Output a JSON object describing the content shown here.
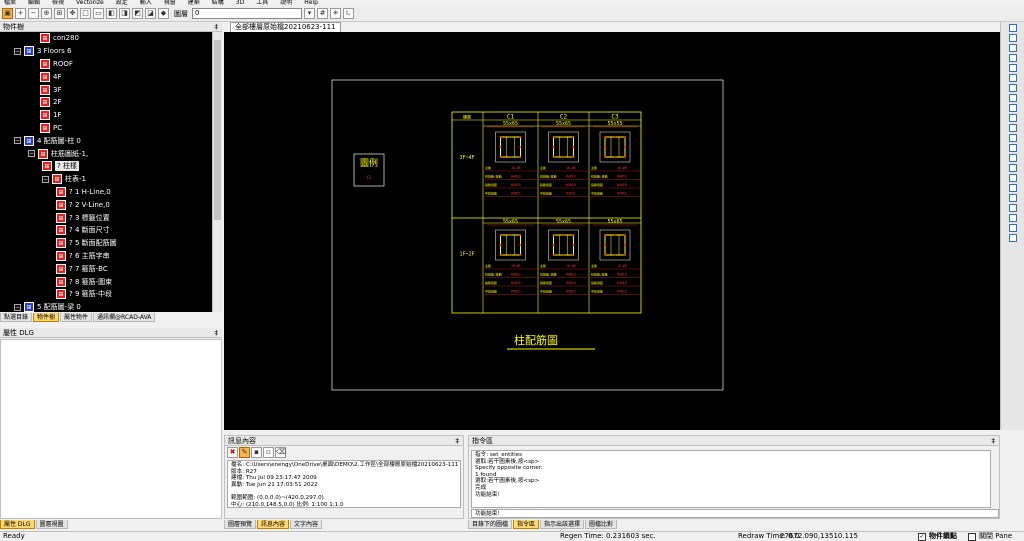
{
  "menu": [
    "檔案",
    "編輯",
    "檢視",
    "Vectorize",
    "設定",
    "輸入",
    "視窗",
    "建築",
    "結構",
    "3D",
    "工具",
    "說明",
    "Help"
  ],
  "toolbar": {
    "combo_label": "圖層",
    "combo_value": "0"
  },
  "tree_panel": {
    "title": "物件樹",
    "rows": [
      {
        "label": "con280",
        "icon": "red"
      },
      {
        "label": "3 Floors 6",
        "icon": "blue"
      },
      {
        "label": "ROOF",
        "icon": "red"
      },
      {
        "label": "4F",
        "icon": "red"
      },
      {
        "label": "3F",
        "icon": "red"
      },
      {
        "label": "2F",
        "icon": "red"
      },
      {
        "label": "1F",
        "icon": "red"
      },
      {
        "label": "PC",
        "icon": "red"
      },
      {
        "label": "4 配筋圖-柱 0",
        "icon": "blue"
      },
      {
        "label": "柱筋圖紙-1,",
        "icon": "red"
      },
      {
        "label": "? 柱樣",
        "icon": "red"
      },
      {
        "label": "柱表-1",
        "icon": "red"
      },
      {
        "label": "? 1 H-Line,0",
        "icon": "red"
      },
      {
        "label": "? 2 V-Line,0",
        "icon": "red"
      },
      {
        "label": "? 3 標籤位置",
        "icon": "red"
      },
      {
        "label": "? 4 斷面尺寸",
        "icon": "red"
      },
      {
        "label": "? 5 斷面配筋圖",
        "icon": "red"
      },
      {
        "label": "? 6 主筋字串",
        "icon": "red"
      },
      {
        "label": "? 7 箍筋-BC",
        "icon": "red"
      },
      {
        "label": "? 8 箍筋-圍束",
        "icon": "red"
      },
      {
        "label": "? 9 箍筋-中段",
        "icon": "red"
      },
      {
        "label": "5 配筋圖-梁 0",
        "icon": "blue"
      }
    ],
    "tabs": [
      "點選目錄",
      "物件樹",
      "屬性物件",
      "通訊欄@RCAD-AVA"
    ]
  },
  "prop_panel": {
    "title": "屬性 DLG",
    "tabs": [
      "屬性 DLG",
      "圖層視圖"
    ]
  },
  "document": {
    "tab_title": "全部樓層原始檔20210623-111"
  },
  "drawing": {
    "legend_label": "圖例",
    "legend_sub": "C1",
    "table_title": "柱配筋圖",
    "header_corner": "樓層",
    "columns": [
      "C1",
      "C2",
      "C3"
    ],
    "rows": [
      {
        "floor": "3F~4F",
        "sizes": [
          "55x65",
          "55x65",
          "55x55"
        ]
      },
      {
        "floor": "1F~2F",
        "sizes": [
          "55x65",
          "55x65",
          "55x65"
        ]
      }
    ],
    "spec_labels": [
      "主筋",
      "柱箍筋/箍筋",
      "箍筋間距",
      "中段箍筋"
    ],
    "spec_values": [
      "16-#8",
      "#4@10",
      "#4@10",
      "#4@15"
    ]
  },
  "msg_panel": {
    "title": "訊息內容",
    "lines": [
      "檔名: C:\\Users\\enengy\\OneDrive\\桌面\\DEMO\\2.工作區\\全部樓層原始檔20210623-111",
      "版本: R27",
      "建檔: Thu Jul 09 23:17:47 2009",
      "異動: Tue Jun 21 17:03:51 2022",
      "",
      "範圍範圍: (0.0,0.0)~(420.0,297.0)",
      "中心: (210.0,148.5,0.0) 比例: 1:100 1:1.0"
    ],
    "tabs": [
      "圖層預覽",
      "訊息內容",
      "文字內容"
    ]
  },
  "cmd_panel": {
    "title": "指令區",
    "lines": [
      "指令: set_entities",
      "選取:若干圖素後,按<sp>",
      "Specify opposite corner:",
      "1 found",
      "選取:若干圖素後,按<sp>",
      "完成",
      "功能結束!"
    ],
    "input": "功能結束!",
    "tabs": [
      "目錄下的圖檔",
      "指令區",
      "指示出該選擇",
      "圖檔比對"
    ]
  },
  "status": {
    "left": "Ready",
    "regen": "Regen Time: 0.231603 sec.",
    "redraw": "Redraw Time: 0.0",
    "coords": "27672.090,13510.115",
    "lock_label": "物件鎖點",
    "close_label": "關閉 Pane"
  },
  "colors": {
    "accent": "#ffd870",
    "yellow": "#ffff00",
    "red": "#ff3030",
    "tree_icon": "#e82020"
  }
}
